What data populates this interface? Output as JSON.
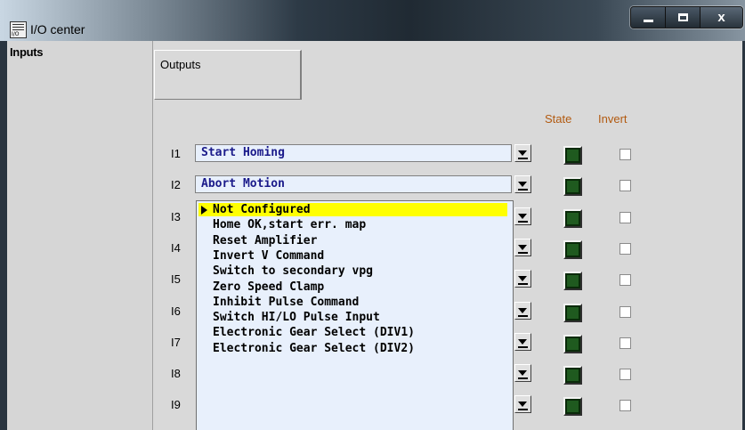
{
  "window": {
    "title": "I/O center",
    "icon_label": "I/O",
    "minimize_icon": "minimize-icon",
    "maximize_icon": "maximize-icon",
    "close_label": "x"
  },
  "tabs": [
    {
      "label": "Inputs",
      "selected": true
    },
    {
      "label": "Outputs",
      "selected": false
    }
  ],
  "columns": {
    "state": "State",
    "invert": "Invert"
  },
  "rows": [
    {
      "label": "I1",
      "value": "Start Homing"
    },
    {
      "label": "I2",
      "value": "Abort Motion"
    },
    {
      "label": "I3",
      "value": ""
    },
    {
      "label": "I4",
      "value": ""
    },
    {
      "label": "I5",
      "value": ""
    },
    {
      "label": "I6",
      "value": ""
    },
    {
      "label": "I7",
      "value": ""
    },
    {
      "label": "I8",
      "value": ""
    },
    {
      "label": "I9",
      "value": ""
    }
  ],
  "dropdown": {
    "selected_index": 0,
    "options": [
      "Not Configured",
      "Home OK,start err. map",
      "Reset Amplifier",
      "Invert V Command",
      "Switch to secondary vpg",
      "Zero Speed Clamp",
      "Inhibit Pulse Command",
      "Switch HI/LO Pulse Input",
      "Electronic Gear Select (DIV1)",
      "Electronic Gear Select (DIV2)"
    ]
  },
  "colors": {
    "header_text": "#b25a10",
    "led_on": "#1f5a1f",
    "combo_bg": "#e8f0fc",
    "highlight": "#ffff00"
  }
}
